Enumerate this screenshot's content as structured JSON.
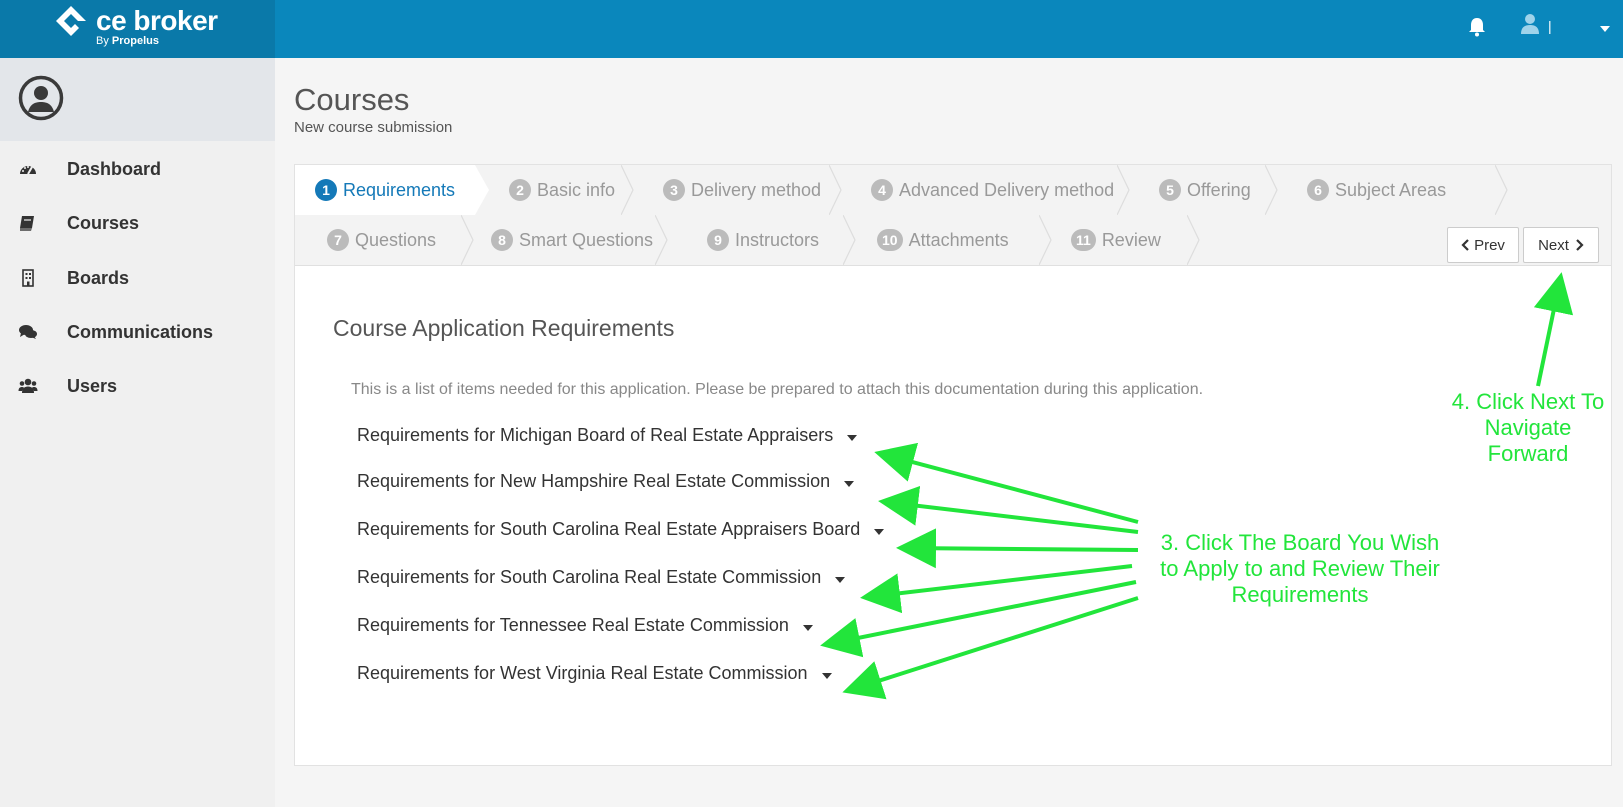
{
  "brand": {
    "name": "ce broker",
    "sub_prefix": "By ",
    "sub_name": "Propelus",
    "logo_icon": "ce-broker-diamond-icon"
  },
  "topbar": {
    "bell_icon": "bell-icon",
    "user_icon": "user-icon",
    "separator": "|",
    "menu_icon": "caret-down-icon"
  },
  "sidebar": {
    "avatar_icon": "user-circle-icon",
    "items": [
      {
        "label": "Dashboard",
        "icon": "dashboard-gauge-icon"
      },
      {
        "label": "Courses",
        "icon": "book-icon"
      },
      {
        "label": "Boards",
        "icon": "building-icon"
      },
      {
        "label": "Communications",
        "icon": "chat-bubbles-icon"
      },
      {
        "label": "Users",
        "icon": "users-icon"
      }
    ]
  },
  "header": {
    "title": "Courses",
    "subtitle": "New course submission"
  },
  "wizard": {
    "steps": [
      {
        "num": "1",
        "label": "Requirements",
        "active": true
      },
      {
        "num": "2",
        "label": "Basic info"
      },
      {
        "num": "3",
        "label": "Delivery method"
      },
      {
        "num": "4",
        "label": "Advanced Delivery method"
      },
      {
        "num": "5",
        "label": "Offering"
      },
      {
        "num": "6",
        "label": "Subject Areas"
      },
      {
        "num": "7",
        "label": "Questions"
      },
      {
        "num": "8",
        "label": "Smart Questions"
      },
      {
        "num": "9",
        "label": "Instructors"
      },
      {
        "num": "10",
        "label": "Attachments"
      },
      {
        "num": "11",
        "label": "Review"
      }
    ],
    "prev_label": "Prev",
    "next_label": "Next"
  },
  "content": {
    "title": "Course Application Requirements",
    "description": "This is a list of items needed for this application. Please be prepared to attach this documentation during this application.",
    "requirements": [
      "Requirements for Michigan Board of Real Estate Appraisers",
      "Requirements for New Hampshire Real Estate Commission",
      "Requirements for South Carolina Real Estate Appraisers Board",
      "Requirements for South Carolina Real Estate Commission",
      "Requirements for Tennessee Real Estate Commission",
      "Requirements for West Virginia Real Estate Commission"
    ]
  },
  "annotations": {
    "board": [
      "3. Click The Board You Wish",
      "to Apply to and Review Their",
      "Requirements"
    ],
    "next": [
      "4. Click Next To",
      "Navigate",
      "Forward"
    ],
    "color": "#22e53b"
  }
}
